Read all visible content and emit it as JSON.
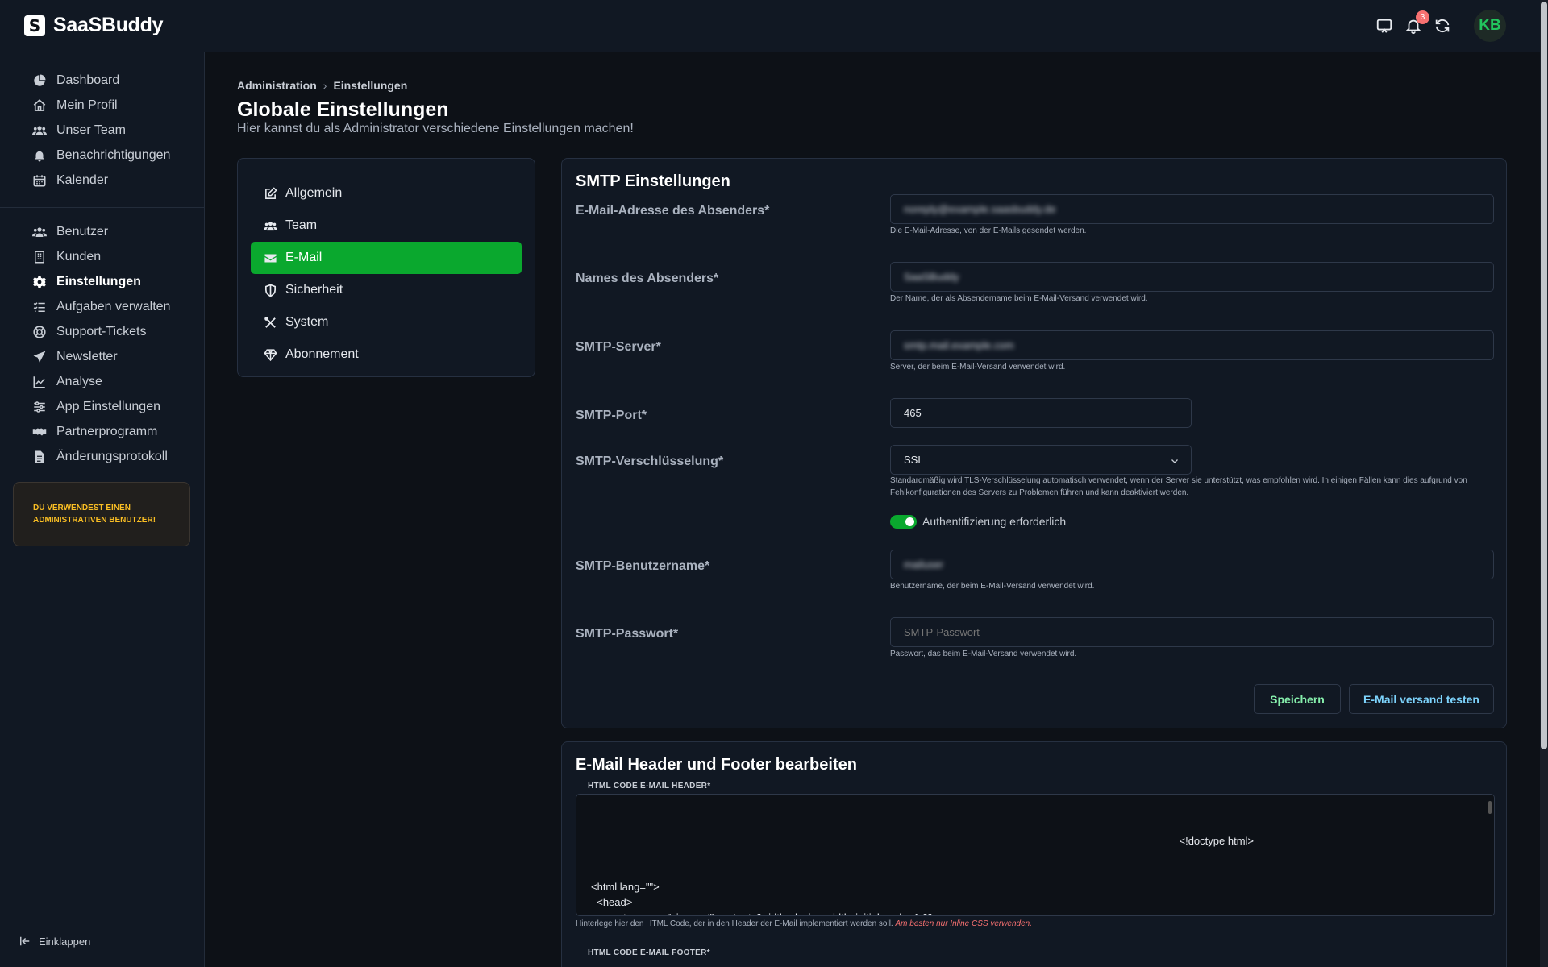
{
  "app": {
    "name": "SaaSBuddy",
    "logo_letter": "S"
  },
  "topbar": {
    "notification_count": "3",
    "avatar_initials": "KB"
  },
  "sidebar": {
    "group1": [
      {
        "label": "Dashboard",
        "icon": "chart-pie-icon"
      },
      {
        "label": "Mein Profil",
        "icon": "home-icon"
      },
      {
        "label": "Unser Team",
        "icon": "users-icon"
      },
      {
        "label": "Benachrichtigungen",
        "icon": "bell-icon"
      },
      {
        "label": "Kalender",
        "icon": "calendar-icon"
      }
    ],
    "group2": [
      {
        "label": "Benutzer",
        "icon": "users-icon"
      },
      {
        "label": "Kunden",
        "icon": "building-icon"
      },
      {
        "label": "Einstellungen",
        "icon": "gear-icon",
        "active": true
      },
      {
        "label": "Aufgaben verwalten",
        "icon": "task-list-icon"
      },
      {
        "label": "Support-Tickets",
        "icon": "lifebuoy-icon"
      },
      {
        "label": "Newsletter",
        "icon": "paper-plane-icon"
      },
      {
        "label": "Analyse",
        "icon": "line-chart-icon"
      },
      {
        "label": "App Einstellungen",
        "icon": "sliders-icon"
      },
      {
        "label": "Partnerprogramm",
        "icon": "handshake-icon"
      },
      {
        "label": "Änderungsprotokoll",
        "icon": "file-icon"
      }
    ],
    "admin_notice": "DU VERWENDEST EINEN ADMINISTRATIVEN BENUTZER!",
    "collapse_label": "Einklappen"
  },
  "breadcrumb": {
    "item1": "Administration",
    "separator": "›",
    "item2": "Einstellungen"
  },
  "page": {
    "title": "Globale Einstellungen",
    "subtitle": "Hier kannst du als Administrator verschiedene Einstellungen machen!"
  },
  "settings_nav": [
    {
      "label": "Allgemein",
      "icon": "edit-icon"
    },
    {
      "label": "Team",
      "icon": "users-icon"
    },
    {
      "label": "E-Mail",
      "icon": "envelope-icon",
      "active": true
    },
    {
      "label": "Sicherheit",
      "icon": "shield-icon"
    },
    {
      "label": "System",
      "icon": "tools-icon"
    },
    {
      "label": "Abonnement",
      "icon": "diamond-icon"
    }
  ],
  "smtp": {
    "title": "SMTP Einstellungen",
    "sender_email": {
      "label": "E-Mail-Adresse des Absenders*",
      "value": "noreply@example.saasbuddy.de",
      "help": "Die E-Mail-Adresse, von der E-Mails gesendet werden."
    },
    "sender_name": {
      "label": "Names des Absenders*",
      "value": "SaaSBuddy",
      "help": "Der Name, der als Absendername beim E-Mail-Versand verwendet wird."
    },
    "server": {
      "label": "SMTP-Server*",
      "value": "smtp.mail.example.com",
      "help": "Server, der beim E-Mail-Versand verwendet wird."
    },
    "port": {
      "label": "SMTP-Port*",
      "value": "465"
    },
    "encryption": {
      "label": "SMTP-Verschlüsselung*",
      "value": "SSL",
      "help": "Standardmäßig wird TLS-Verschlüsselung automatisch verwendet, wenn der Server sie unterstützt, was empfohlen wird. In einigen Fällen kann dies aufgrund von Fehlkonfigurationen des Servers zu Problemen führen und kann deaktiviert werden."
    },
    "auth_toggle": {
      "label": "Authentifizierung erforderlich",
      "on": true
    },
    "username": {
      "label": "SMTP-Benutzername*",
      "value": "mailuser",
      "help": "Benutzername, der beim E-Mail-Versand verwendet wird."
    },
    "password": {
      "label": "SMTP-Passwort*",
      "placeholder": "SMTP-Passwort",
      "help": "Passwort, das beim E-Mail-Versand verwendet wird."
    },
    "save_label": "Speichern",
    "test_label": "E-Mail versand testen"
  },
  "header_footer": {
    "title": "E-Mail Header und Footer bearbeiten",
    "header_label": "HTML CODE E-MAIL HEADER*",
    "header_code_first": "<!doctype html>",
    "header_code": "<html lang=\"\">\n  <head>\n    <meta name=\"viewport\" content=\"width=device-width, initial-scale=1.0\">\n    <meta http-equiv=\"Content-Type\" content=\"text/html; charset=UTF-8\">\n    <style media=\"all\" type=\"text/css\">\n@media all {\n  .btn-primary table td:hover {",
    "header_help": "Hinterlege hier den HTML Code, der in den Header der E-Mail implementiert werden soll.",
    "header_help_warn": "Am besten nur Inline CSS verwenden.",
    "footer_label": "HTML CODE E-MAIL FOOTER*"
  },
  "colors": {
    "accent_green": "#0aa82e",
    "warning": "#fbbf24",
    "link_blue": "#7dd3fc"
  }
}
